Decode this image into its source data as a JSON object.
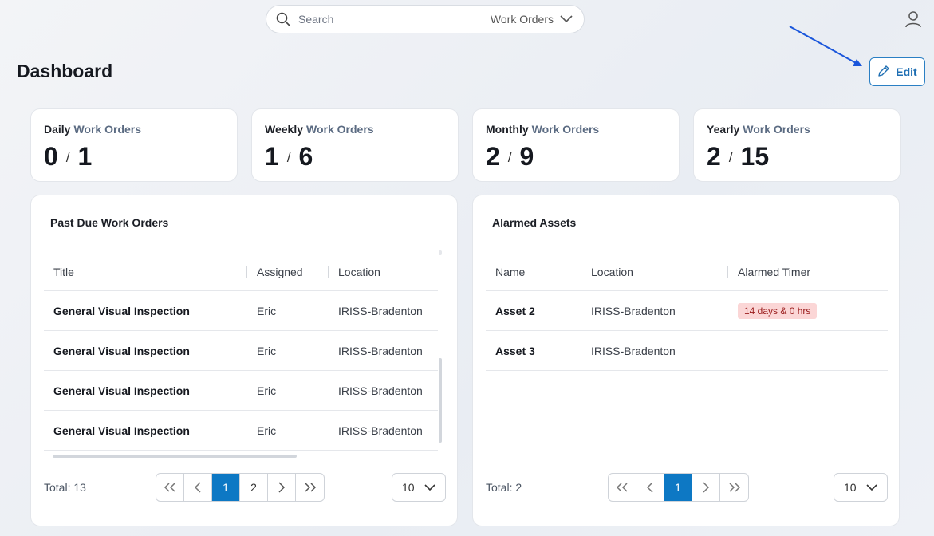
{
  "search": {
    "placeholder": "Search",
    "scope": "Work Orders"
  },
  "page": {
    "title": "Dashboard",
    "edit_label": "Edit"
  },
  "stats": [
    {
      "period": "Daily",
      "label": "Work Orders",
      "done": "0",
      "total": "1"
    },
    {
      "period": "Weekly",
      "label": "Work Orders",
      "done": "1",
      "total": "6"
    },
    {
      "period": "Monthly",
      "label": "Work Orders",
      "done": "2",
      "total": "9"
    },
    {
      "period": "Yearly",
      "label": "Work Orders",
      "done": "2",
      "total": "15"
    }
  ],
  "stat_separator": "/",
  "past_due": {
    "title": "Past Due Work Orders",
    "columns": [
      "Title",
      "Assigned",
      "Location"
    ],
    "rows": [
      {
        "title": "General Visual Inspection",
        "assigned": "Eric",
        "location": "IRISS-Bradenton"
      },
      {
        "title": "General Visual Inspection",
        "assigned": "Eric",
        "location": "IRISS-Bradenton"
      },
      {
        "title": "General Visual Inspection",
        "assigned": "Eric",
        "location": "IRISS-Bradenton"
      },
      {
        "title": "General Visual Inspection",
        "assigned": "Eric",
        "location": "IRISS-Bradenton"
      }
    ],
    "total": "Total: 13",
    "pages": [
      "1",
      "2"
    ],
    "current_page": "1",
    "page_size": "10"
  },
  "alarmed": {
    "title": "Alarmed Assets",
    "columns": [
      "Name",
      "Location",
      "Alarmed Timer"
    ],
    "rows": [
      {
        "name": "Asset 2",
        "location": "IRISS-Bradenton",
        "timer": "14 days & 0 hrs"
      },
      {
        "name": "Asset 3",
        "location": "IRISS-Bradenton",
        "timer": ""
      }
    ],
    "total": "Total: 2",
    "pages": [
      "1"
    ],
    "current_page": "1",
    "page_size": "10"
  },
  "colors": {
    "accent": "#0d78c4",
    "badge_bg": "#fbd6d6",
    "badge_text": "#9a1c1c",
    "annotation_arrow": "#1a56db"
  },
  "icons": [
    "search-icon",
    "chevron-down-icon",
    "user-icon",
    "pencil-icon",
    "double-chevron-left-icon",
    "chevron-left-icon",
    "chevron-right-icon",
    "double-chevron-right-icon"
  ]
}
